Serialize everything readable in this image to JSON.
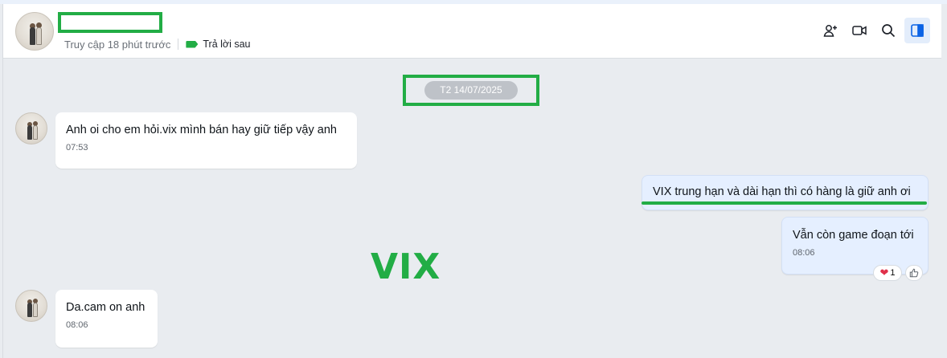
{
  "header": {
    "access_status": "Truy cập 18 phút trước",
    "tag_label": "Trả lời sau",
    "tag_color": "#22ad45",
    "icons": [
      "add-member-icon",
      "video-call-icon",
      "search-icon",
      "sidebar-toggle-icon"
    ]
  },
  "conversation": {
    "date_chip": "T2 14/07/2025",
    "messages": [
      {
        "sender": "contact",
        "text": "Anh oi cho em hỏi.vix mình bán hay giữ tiếp vậy anh",
        "time": "07:53"
      },
      {
        "sender": "me",
        "text": "VIX trung hạn và dài hạn thì có hàng là giữ anh ơi",
        "time": ""
      },
      {
        "sender": "me",
        "text": "Vẫn còn game đoạn tới",
        "time": "08:06",
        "reaction": {
          "emoji": "❤️",
          "count": "1"
        }
      },
      {
        "sender": "contact",
        "text": "Da.cam on anh",
        "time": "08:06"
      }
    ]
  },
  "watermark": "VIX",
  "colors": {
    "highlight": "#22ad45",
    "my_bubble": "#e5efff",
    "contact_bubble": "#ffffff",
    "chat_background": "#e9ecf0"
  }
}
